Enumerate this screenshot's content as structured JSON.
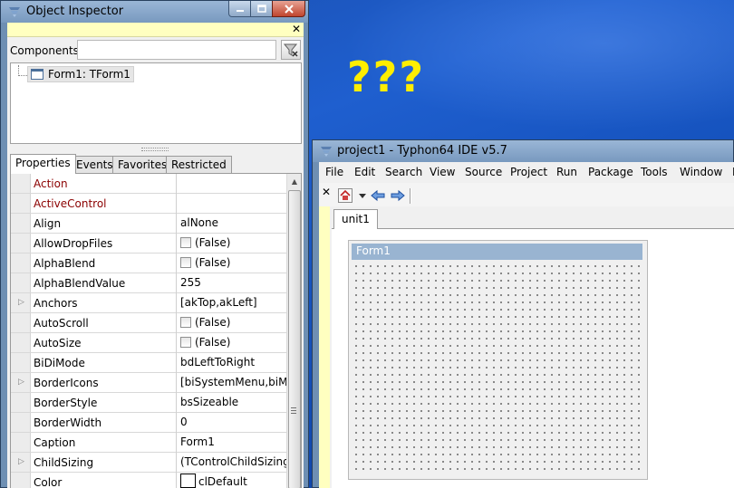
{
  "desktop": {
    "annotation": "???"
  },
  "object_inspector": {
    "title": "Object Inspector",
    "components_label": "Components",
    "components_filter_value": "",
    "tree": {
      "root_node": "Form1: TForm1"
    },
    "tabs": [
      {
        "label": "Properties",
        "active": true
      },
      {
        "label": "Events",
        "active": false
      },
      {
        "label": "Favorites",
        "active": false
      },
      {
        "label": "Restricted",
        "active": false
      }
    ],
    "properties": [
      {
        "name": "Action",
        "value": "",
        "highlight": true,
        "expandable": false,
        "checkbox": false
      },
      {
        "name": "ActiveControl",
        "value": "",
        "highlight": true,
        "expandable": false,
        "checkbox": false
      },
      {
        "name": "Align",
        "value": "alNone",
        "highlight": false,
        "expandable": false,
        "checkbox": false
      },
      {
        "name": "AllowDropFiles",
        "value": "(False)",
        "highlight": false,
        "expandable": false,
        "checkbox": true
      },
      {
        "name": "AlphaBlend",
        "value": "(False)",
        "highlight": false,
        "expandable": false,
        "checkbox": true
      },
      {
        "name": "AlphaBlendValue",
        "value": "255",
        "highlight": false,
        "expandable": false,
        "checkbox": false
      },
      {
        "name": "Anchors",
        "value": "[akTop,akLeft]",
        "highlight": false,
        "expandable": true,
        "checkbox": false
      },
      {
        "name": "AutoScroll",
        "value": "(False)",
        "highlight": false,
        "expandable": false,
        "checkbox": true
      },
      {
        "name": "AutoSize",
        "value": "(False)",
        "highlight": false,
        "expandable": false,
        "checkbox": true
      },
      {
        "name": "BiDiMode",
        "value": "bdLeftToRight",
        "highlight": false,
        "expandable": false,
        "checkbox": false
      },
      {
        "name": "BorderIcons",
        "value": "[biSystemMenu,biMin",
        "highlight": false,
        "expandable": true,
        "checkbox": false
      },
      {
        "name": "BorderStyle",
        "value": "bsSizeable",
        "highlight": false,
        "expandable": false,
        "checkbox": false
      },
      {
        "name": "BorderWidth",
        "value": "0",
        "highlight": false,
        "expandable": false,
        "checkbox": false
      },
      {
        "name": "Caption",
        "value": "Form1",
        "highlight": false,
        "expandable": false,
        "checkbox": false
      },
      {
        "name": "ChildSizing",
        "value": "(TControlChildSizing)",
        "highlight": false,
        "expandable": true,
        "checkbox": false
      },
      {
        "name": "Color",
        "value": "clDefault",
        "highlight": false,
        "expandable": false,
        "checkbox": false,
        "swatch": "#ffffff"
      }
    ]
  },
  "ide": {
    "title": "project1 - Typhon64 IDE v5.7",
    "menu": [
      "File",
      "Edit",
      "Search",
      "View",
      "Source",
      "Project",
      "Run",
      "Package",
      "Tools",
      "Window",
      "H"
    ],
    "editor_tab": "unit1",
    "form": {
      "caption": "Form1"
    }
  },
  "colors": {
    "desktop_blue": "#1a4fb0",
    "annotation_yellow": "#ffee00",
    "window_frame": "#7899bf",
    "highlight_property": "#8b0000",
    "form_caption_bg": "#99b4d1",
    "inspector_bar": "#ffffc0"
  }
}
